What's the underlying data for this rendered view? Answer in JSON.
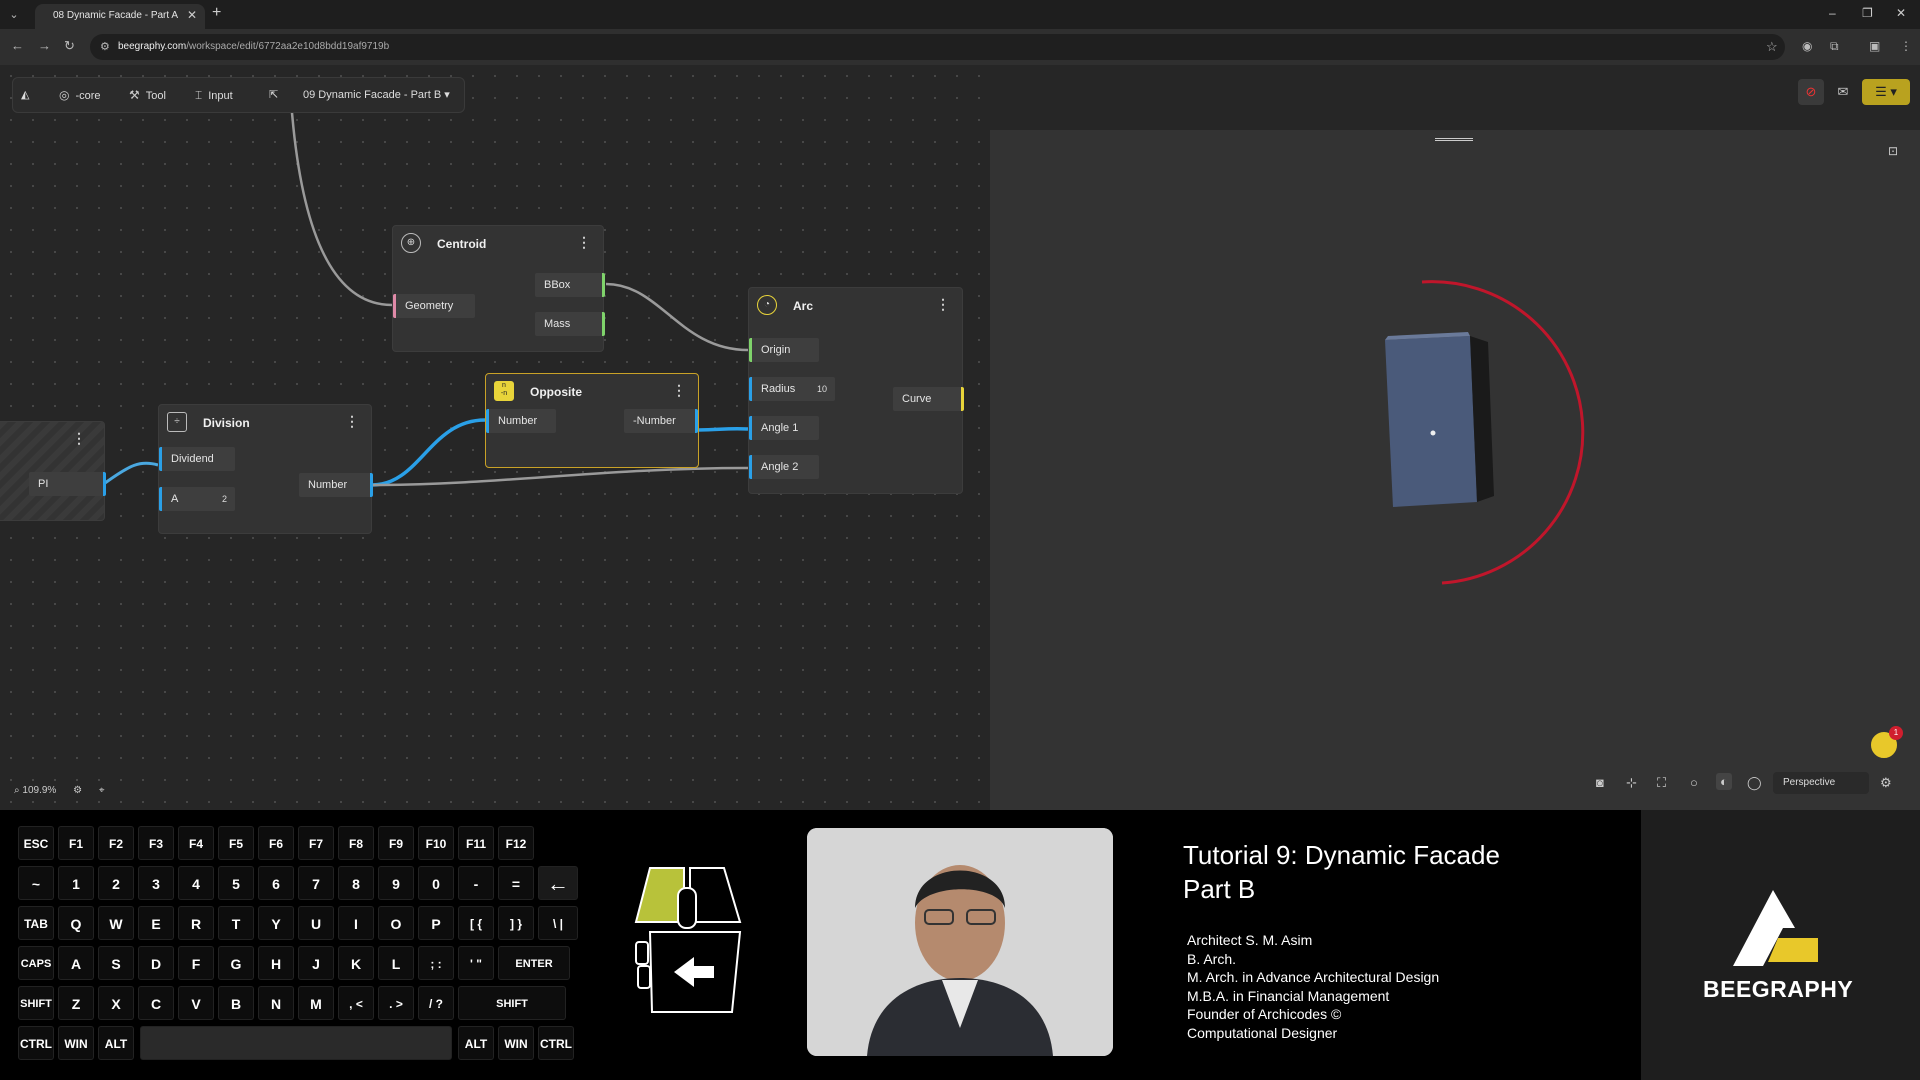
{
  "browser": {
    "tab_title": "08 Dynamic Facade - Part A",
    "tab_close": "✕",
    "new_tab": "+",
    "url_host": "beegraphy.com",
    "url_path": "/workspace/edit/6772aa2e10d8bdd19af9719b"
  },
  "toolbar": {
    "core_label": "-core",
    "tool_label": "Tool",
    "input_label": "Input",
    "project_label": "09 Dynamic Facade - Part B"
  },
  "nodes": {
    "centroid": {
      "title": "Centroid",
      "input_geometry": "Geometry",
      "out_bbox": "BBox",
      "out_mass": "Mass"
    },
    "arc": {
      "title": "Arc",
      "in_origin": "Origin",
      "in_radius": "Radius",
      "radius_value": "10",
      "in_angle1": "Angle 1",
      "in_angle2": "Angle 2",
      "out_curve": "Curve"
    },
    "opposite": {
      "title": "Opposite",
      "in_number": "Number",
      "out_number": "-Number",
      "icon_top": "n",
      "icon_bottom": "-n"
    },
    "division": {
      "title": "Division",
      "in_dividend": "Dividend",
      "in_a": "A",
      "a_value": "2",
      "out_number": "Number"
    },
    "pi": {
      "label": "PI"
    }
  },
  "canvas": {
    "zoom": "109.9%"
  },
  "viewport": {
    "camera_mode": "Perspective",
    "notification_count": "1"
  },
  "keyboard": {
    "rows": [
      [
        "ESC",
        "F1",
        "F2",
        "F3",
        "F4",
        "F5",
        "F6",
        "F7",
        "F8",
        "F9",
        "F10",
        "F11",
        "F12"
      ],
      [
        "~",
        "1",
        "2",
        "3",
        "4",
        "5",
        "6",
        "7",
        "8",
        "9",
        "0",
        "-",
        "=",
        "←"
      ],
      [
        "TAB",
        "Q",
        "W",
        "E",
        "R",
        "T",
        "Y",
        "U",
        "I",
        "O",
        "P",
        "[ {",
        "] }",
        "\\ |"
      ],
      [
        "CAPS",
        "A",
        "S",
        "D",
        "F",
        "G",
        "H",
        "J",
        "K",
        "L",
        "; :",
        "' \"",
        "ENTER"
      ],
      [
        "SHIFT",
        "Z",
        "X",
        "C",
        "V",
        "B",
        "N",
        "M",
        ", <",
        ". >",
        "/ ?",
        "SHIFT"
      ],
      [
        "CTRL",
        "WIN",
        "ALT",
        "ALT",
        "WIN",
        "CTRL"
      ]
    ]
  },
  "tutorial": {
    "title_line1": "Tutorial 9: Dynamic Facade",
    "title_line2": "Part B",
    "credits": [
      "Architect S. M. Asim",
      "B. Arch.",
      "M. Arch. in Advance Architectural Design",
      "M.B.A. in Financial Management",
      "Founder of Archicodes ©",
      "Computational Designer"
    ]
  },
  "brand": {
    "name": "BEEGRAPHY"
  },
  "colors": {
    "accent_blue": "#2aa0e8",
    "selection": "#c9a227",
    "arc_red": "#c0162b",
    "mouse_highlight": "#b8c23a"
  }
}
